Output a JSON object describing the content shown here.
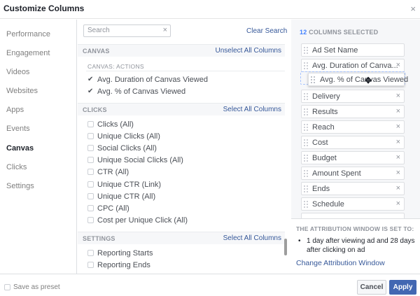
{
  "dialog": {
    "title": "Customize Columns",
    "close_glyph": "×"
  },
  "nav": {
    "items": [
      {
        "label": "Performance",
        "active": false
      },
      {
        "label": "Engagement",
        "active": false
      },
      {
        "label": "Videos",
        "active": false
      },
      {
        "label": "Websites",
        "active": false
      },
      {
        "label": "Apps",
        "active": false
      },
      {
        "label": "Events",
        "active": false
      },
      {
        "label": "Canvas",
        "active": true
      },
      {
        "label": "Clicks",
        "active": false
      },
      {
        "label": "Settings",
        "active": false
      }
    ]
  },
  "search": {
    "placeholder": "Search",
    "clear_glyph": "×",
    "clear_label": "Clear Search"
  },
  "canvas_section": {
    "name": "CANVAS",
    "action": "Unselect All Columns",
    "sublabel": "CANVAS: ACTIONS",
    "items": [
      {
        "label": "Avg. Duration of Canvas Viewed",
        "checked": true
      },
      {
        "label": "Avg. % of Canvas Viewed",
        "checked": true
      }
    ]
  },
  "clicks_section": {
    "name": "CLICKS",
    "action": "Select All Columns",
    "items": [
      {
        "label": "Clicks (All)",
        "checked": false
      },
      {
        "label": "Unique Clicks (All)",
        "checked": false
      },
      {
        "label": "Social Clicks (All)",
        "checked": false
      },
      {
        "label": "Unique Social Clicks (All)",
        "checked": false
      },
      {
        "label": "CTR (All)",
        "checked": false
      },
      {
        "label": "Unique CTR (Link)",
        "checked": false
      },
      {
        "label": "Unique CTR (All)",
        "checked": false
      },
      {
        "label": "CPC (All)",
        "checked": false
      },
      {
        "label": "Cost per Unique Click (All)",
        "checked": false
      }
    ]
  },
  "settings_section": {
    "name": "SETTINGS",
    "action": "Select All Columns",
    "items": [
      {
        "label": "Reporting Starts",
        "checked": false
      },
      {
        "label": "Reporting Ends",
        "checked": false
      }
    ]
  },
  "selected": {
    "count": "12",
    "count_label": "COLUMNS SELECTED",
    "remove_glyph": "×",
    "columns": [
      {
        "label": "Ad Set Name",
        "removable": false
      },
      {
        "label": "Avg. Duration of Canva...",
        "removable": true
      },
      {
        "label": "Delivery",
        "removable": true
      },
      {
        "label": "Results",
        "removable": true
      },
      {
        "label": "Reach",
        "removable": true
      },
      {
        "label": "Cost",
        "removable": true
      },
      {
        "label": "Budget",
        "removable": true
      },
      {
        "label": "Amount Spent",
        "removable": true
      },
      {
        "label": "Ends",
        "removable": true
      },
      {
        "label": "Schedule",
        "removable": true
      }
    ],
    "dragging_label": "Avg. % of Canvas Viewed"
  },
  "attribution": {
    "heading": "THE ATTRIBUTION WINDOW IS SET TO:",
    "bullet": "•",
    "description": "1 day after viewing ad and 28 days after clicking on ad",
    "change_label": "Change Attribution Window"
  },
  "footer": {
    "preset_label": "Save as preset",
    "cancel_label": "Cancel",
    "apply_label": "Apply"
  },
  "colors": {
    "link": "#365899",
    "accent": "#4080ff",
    "primary_button": "#4267b2",
    "panel_bg": "#f6f7f9"
  },
  "icons": {
    "check": "✔",
    "move": "✥"
  }
}
